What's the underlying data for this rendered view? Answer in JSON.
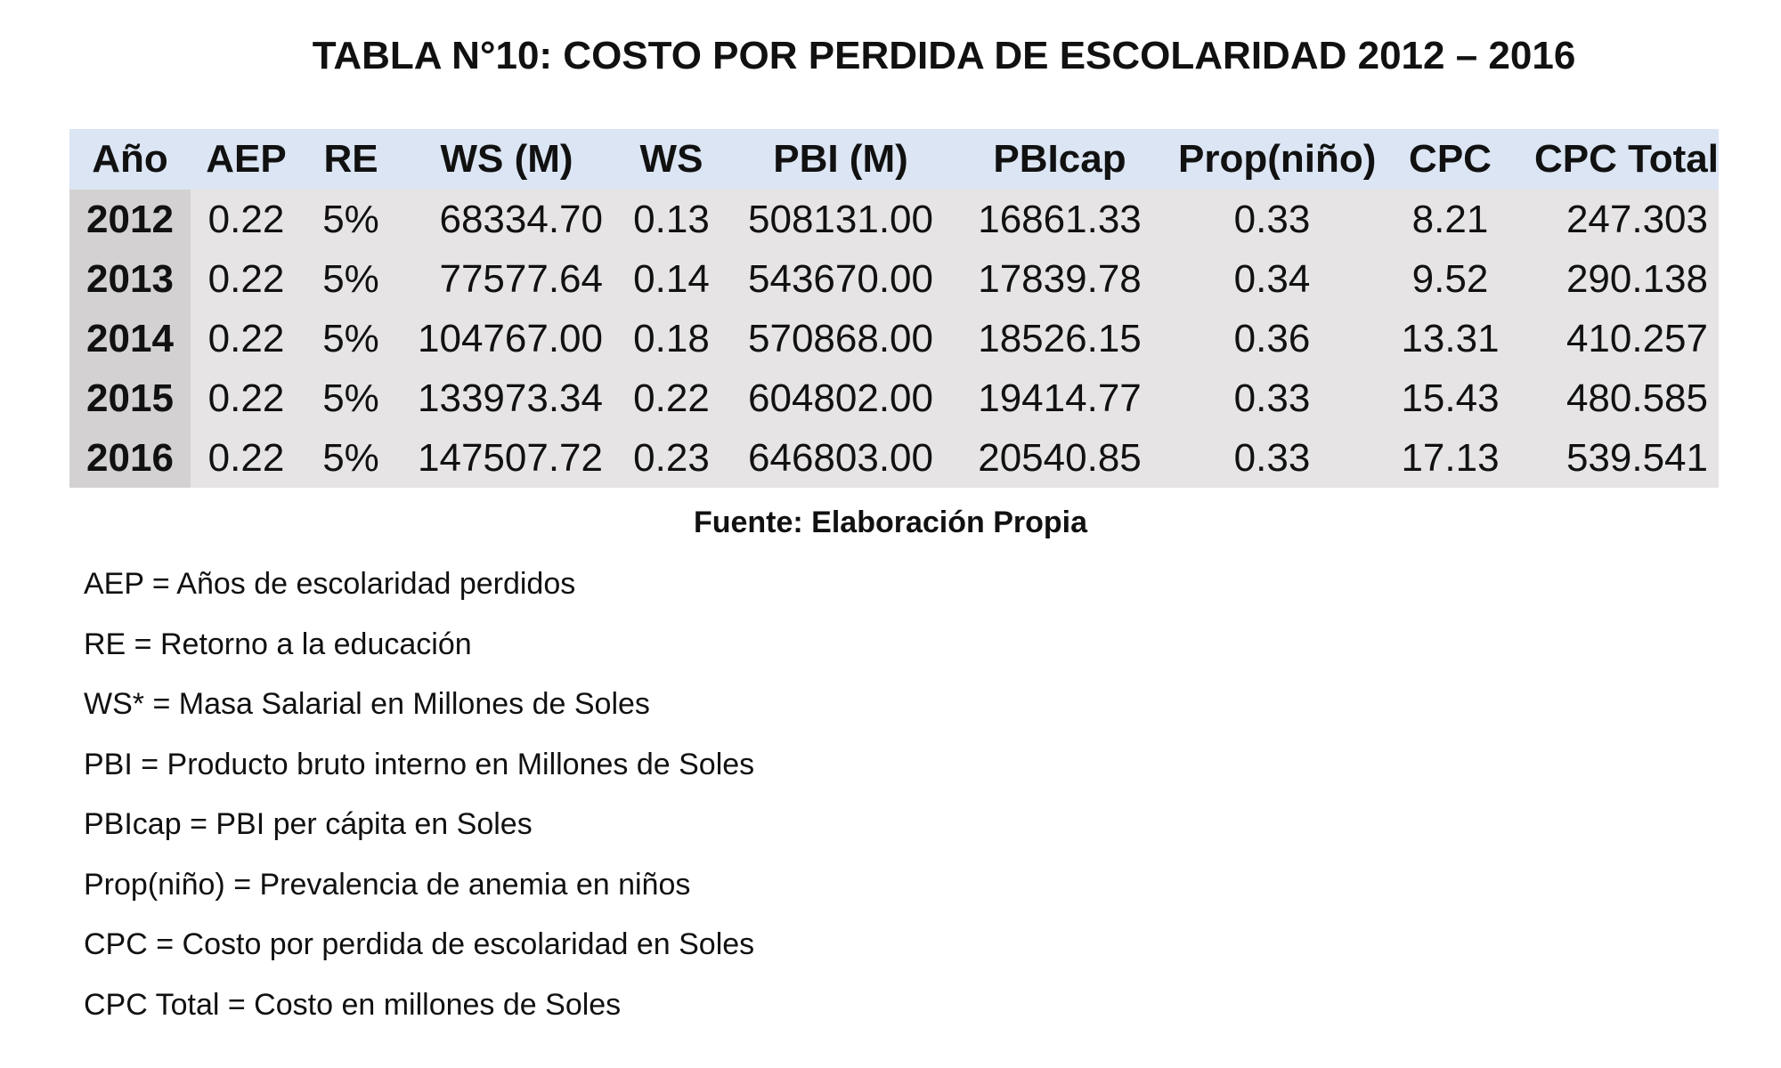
{
  "title": "TABLA N°10: COSTO POR PERDIDA DE ESCOLARIDAD 2012 – 2016",
  "table": {
    "headers": [
      "Año",
      "AEP",
      "RE",
      "WS (M)",
      "WS",
      "PBI (M)",
      "PBIcap",
      "Prop(niño)",
      "CPC",
      "CPC Total"
    ],
    "rows": [
      [
        "2012",
        "0.22",
        "5%",
        "68334.70",
        "0.13",
        "508131.00",
        "16861.33",
        "0.33",
        "8.21",
        "247.303"
      ],
      [
        "2013",
        "0.22",
        "5%",
        "77577.64",
        "0.14",
        "543670.00",
        "17839.78",
        "0.34",
        "9.52",
        "290.138"
      ],
      [
        "2014",
        "0.22",
        "5%",
        "104767.00",
        "0.18",
        "570868.00",
        "18526.15",
        "0.36",
        "13.31",
        "410.257"
      ],
      [
        "2015",
        "0.22",
        "5%",
        "133973.34",
        "0.22",
        "604802.00",
        "19414.77",
        "0.33",
        "15.43",
        "480.585"
      ],
      [
        "2016",
        "0.22",
        "5%",
        "147507.72",
        "0.23",
        "646803.00",
        "20540.85",
        "0.33",
        "17.13",
        "539.541"
      ]
    ]
  },
  "source": "Fuente: Elaboración Propia",
  "legend": [
    "AEP = Años de escolaridad perdidos",
    "RE = Retorno a la educación",
    "WS* = Masa Salarial en Millones de Soles",
    "PBI = Producto bruto interno en Millones de Soles",
    "PBIcap = PBI per cápita en Soles",
    "Prop(niño) = Prevalencia de anemia en niños",
    "CPC = Costo por perdida de escolaridad en Soles",
    "CPC Total = Costo en millones de Soles"
  ],
  "colors": {
    "header_bg": "#dbe5f3",
    "body_bg": "#e6e4e4",
    "year_bg": "#d3d1d1"
  }
}
